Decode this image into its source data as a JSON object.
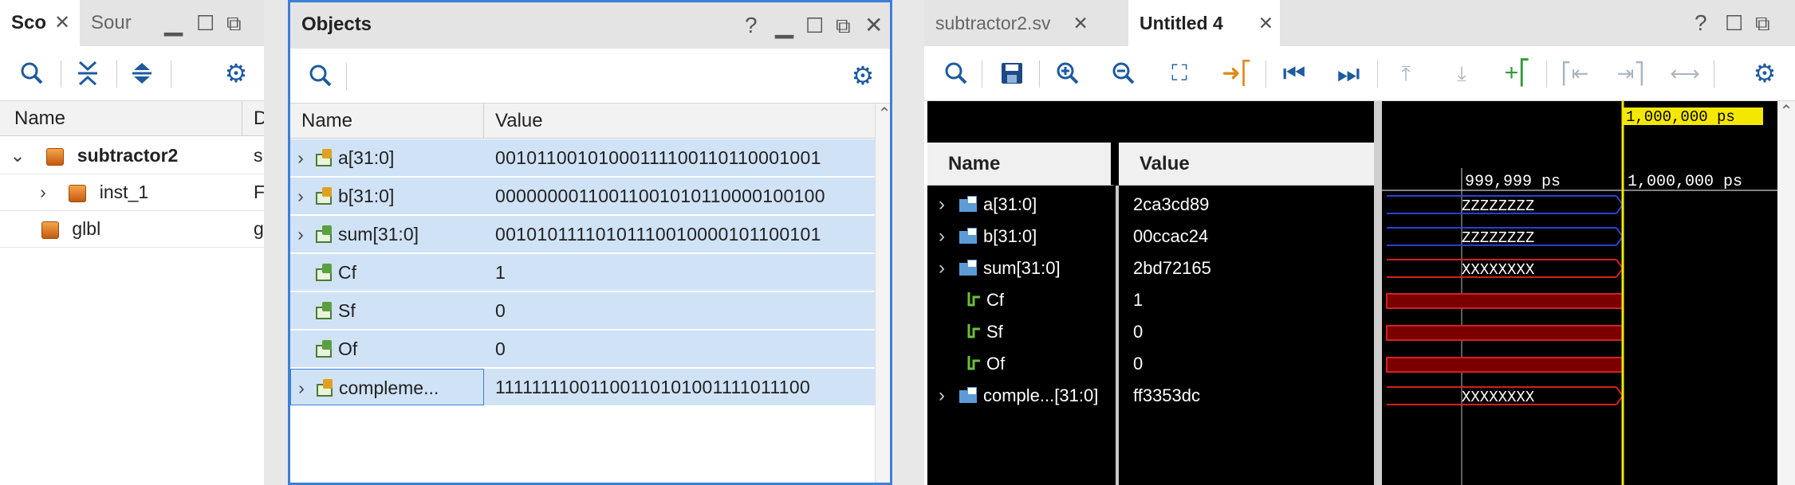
{
  "scope_panel": {
    "tabs": [
      {
        "label": "Sco",
        "close": "✕"
      },
      {
        "label": "Sour"
      }
    ],
    "window_controls": [
      "minimize-icon",
      "maximize-icon",
      "float-icon"
    ],
    "toolbar": [
      "search-icon",
      "collapse-all-icon",
      "expand-all-icon",
      "gear-icon"
    ],
    "columns": [
      "Name",
      "D"
    ],
    "rows": [
      {
        "name": "subtractor2",
        "col2": "s",
        "bold": true,
        "expanded": true
      },
      {
        "name": "inst_1",
        "col2": "F",
        "bold": false,
        "expanded": false
      },
      {
        "name": "glbl",
        "col2": "g",
        "bold": false
      }
    ]
  },
  "objects_panel": {
    "title": "Objects",
    "help": "?",
    "toolbar": [
      "search-icon",
      "gear-icon"
    ],
    "columns": [
      "Name",
      "Value"
    ],
    "rows": [
      {
        "name": "a[31:0]",
        "value": "00101100101000111100110110001001",
        "expandable": true,
        "icon": "input-bus-icon"
      },
      {
        "name": "b[31:0]",
        "value": "00000000110011001010110000100100",
        "expandable": true,
        "icon": "input-bus-icon"
      },
      {
        "name": "sum[31:0]",
        "value": "00101011110101110010000101100101",
        "expandable": true,
        "icon": "output-bus-icon"
      },
      {
        "name": "Cf",
        "value": "1",
        "expandable": false,
        "icon": "output-signal-icon"
      },
      {
        "name": "Sf",
        "value": "0",
        "expandable": false,
        "icon": "output-signal-icon"
      },
      {
        "name": "Of",
        "value": "0",
        "expandable": false,
        "icon": "output-signal-icon"
      },
      {
        "name": "compleme...",
        "value": "11111111001100110101001111011100",
        "expandable": true,
        "icon": "internal-bus-icon"
      }
    ]
  },
  "wave_panel": {
    "tabs": [
      {
        "label": "subtractor2.sv",
        "close": "✕"
      },
      {
        "label": "Untitled 4",
        "close": "✕"
      }
    ],
    "help": "?",
    "toolbar": [
      "search-icon",
      "save-icon",
      "zoom-in-icon",
      "zoom-out-icon",
      "zoom-fit-icon",
      "go-to-cursor-icon",
      "go-to-start-icon",
      "go-to-end-icon",
      "prev-transition-icon",
      "next-transition-icon",
      "add-marker-icon",
      "prev-marker-icon",
      "next-marker-icon",
      "swap-cursors-icon",
      "gear-icon"
    ],
    "columns": {
      "name": "Name",
      "value": "Value"
    },
    "cursor_label": "1,000,000 ps",
    "time_ticks": [
      "999,999 ps",
      "1,000,000 ps"
    ],
    "signals": [
      {
        "name": "a[31:0]",
        "value": "2ca3cd89",
        "bus": true,
        "wave": "ZZZZZZZZ",
        "color": "#2c3fd6"
      },
      {
        "name": "b[31:0]",
        "value": "00ccac24",
        "bus": true,
        "wave": "ZZZZZZZZ",
        "color": "#2c3fd6"
      },
      {
        "name": "sum[31:0]",
        "value": "2bd72165",
        "bus": true,
        "wave": "XXXXXXXX",
        "color": "#d42020"
      },
      {
        "name": "Cf",
        "value": "1",
        "bus": false,
        "wave": "",
        "color": "#d42020"
      },
      {
        "name": "Sf",
        "value": "0",
        "bus": false,
        "wave": "",
        "color": "#d42020"
      },
      {
        "name": "Of",
        "value": "0",
        "bus": false,
        "wave": "",
        "color": "#d42020"
      },
      {
        "name": "comple...[31:0]",
        "value": "ff3353dc",
        "bus": true,
        "wave": "XXXXXXXX",
        "color": "#d42020"
      }
    ],
    "cursor_color": "#f5e800"
  }
}
